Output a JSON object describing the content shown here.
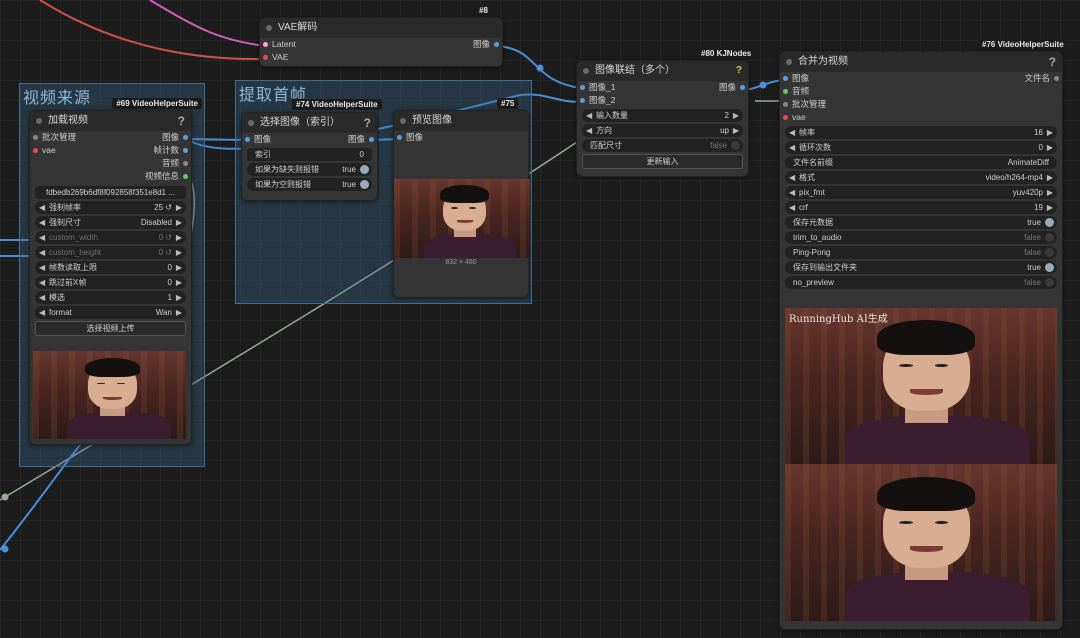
{
  "colors": {
    "image_pin": "#5aa0e0",
    "latent_pin": "#ff9ce0",
    "vae_pin": "#e05050",
    "audio_pin": "#8aa",
    "gray_pin": "#888",
    "green_pin": "#6c6",
    "wire_blue": "#4a8fd8",
    "wire_red": "#d0504a",
    "wire_pink": "#d060c0",
    "wire_gray": "#9aa89a"
  },
  "vae_node": {
    "title": "VAE解码",
    "id": "#8",
    "inputs": [
      "Latent",
      "VAE"
    ],
    "output": "图像"
  },
  "group_video_source": {
    "title": "视频来源",
    "badge": "#69 VideoHelperSuite"
  },
  "group_extract": {
    "title": "提取首帧",
    "badge": "#74 VideoHelperSuite"
  },
  "load_video": {
    "title": "加载视频",
    "help": "?",
    "inputs": [
      "批次管理",
      "vae"
    ],
    "outputs": [
      "图像",
      "帧计数",
      "音频",
      "视频信息"
    ],
    "file": "fdbedb269b6df8f092858f351e8d1 ...",
    "widgets": [
      {
        "label": "强制帧率",
        "value": "25 ↺"
      },
      {
        "label": "强制尺寸",
        "value": "Disabled"
      },
      {
        "label": "custom_width",
        "value": "0 ↺"
      },
      {
        "label": "custom_height",
        "value": "0 ↺"
      },
      {
        "label": "帧数读取上限",
        "value": "0"
      },
      {
        "label": "跳过前X帧",
        "value": "0"
      },
      {
        "label": "模选",
        "value": "1"
      },
      {
        "label": "format",
        "value": "Wan"
      }
    ],
    "upload_button": "选择视频上传"
  },
  "select_image": {
    "title": "选择图像（索引）",
    "help": "?",
    "input": "图像",
    "output": "图像",
    "widgets": [
      {
        "label": "索引",
        "value": "0"
      },
      {
        "label": "如果为缺失则报错",
        "value": "true"
      },
      {
        "label": "如果为空则报错",
        "value": "true"
      }
    ]
  },
  "preview": {
    "id": "#75",
    "title": "预览图像",
    "input": "图像",
    "size": "832 × 480"
  },
  "concat": {
    "badge": "#80 KJNodes",
    "title": "图像联结（多个）",
    "help": "?",
    "inputs": [
      "图像_1",
      "图像_2"
    ],
    "output": "图像",
    "widgets": [
      {
        "label": "输入数量",
        "value": "2"
      },
      {
        "label": "方向",
        "value": "up"
      },
      {
        "label": "匹配尺寸",
        "value": "false"
      }
    ],
    "update_button": "更新输入"
  },
  "combine": {
    "badge": "#76 VideoHelperSuite",
    "title": "合并为视频",
    "help": "?",
    "inputs": [
      "图像",
      "音频",
      "批次管理",
      "vae"
    ],
    "output": "文件名",
    "widgets": [
      {
        "label": "帧率",
        "value": "16"
      },
      {
        "label": "循环次数",
        "value": "0"
      },
      {
        "label": "文件名前缀",
        "value": "AnimateDiff"
      },
      {
        "label": "格式",
        "value": "video/h264-mp4"
      },
      {
        "label": "pix_fmt",
        "value": "yuv420p"
      },
      {
        "label": "crf",
        "value": "19"
      },
      {
        "label": "保存元数据",
        "value": "true"
      },
      {
        "label": "trim_to_audio",
        "value": "false"
      },
      {
        "label": "Ping-Pong",
        "value": "false"
      },
      {
        "label": "保存到输出文件夹",
        "value": "true"
      },
      {
        "label": "no_preview",
        "value": "false"
      }
    ],
    "watermark": "RunningHub AI生成"
  }
}
